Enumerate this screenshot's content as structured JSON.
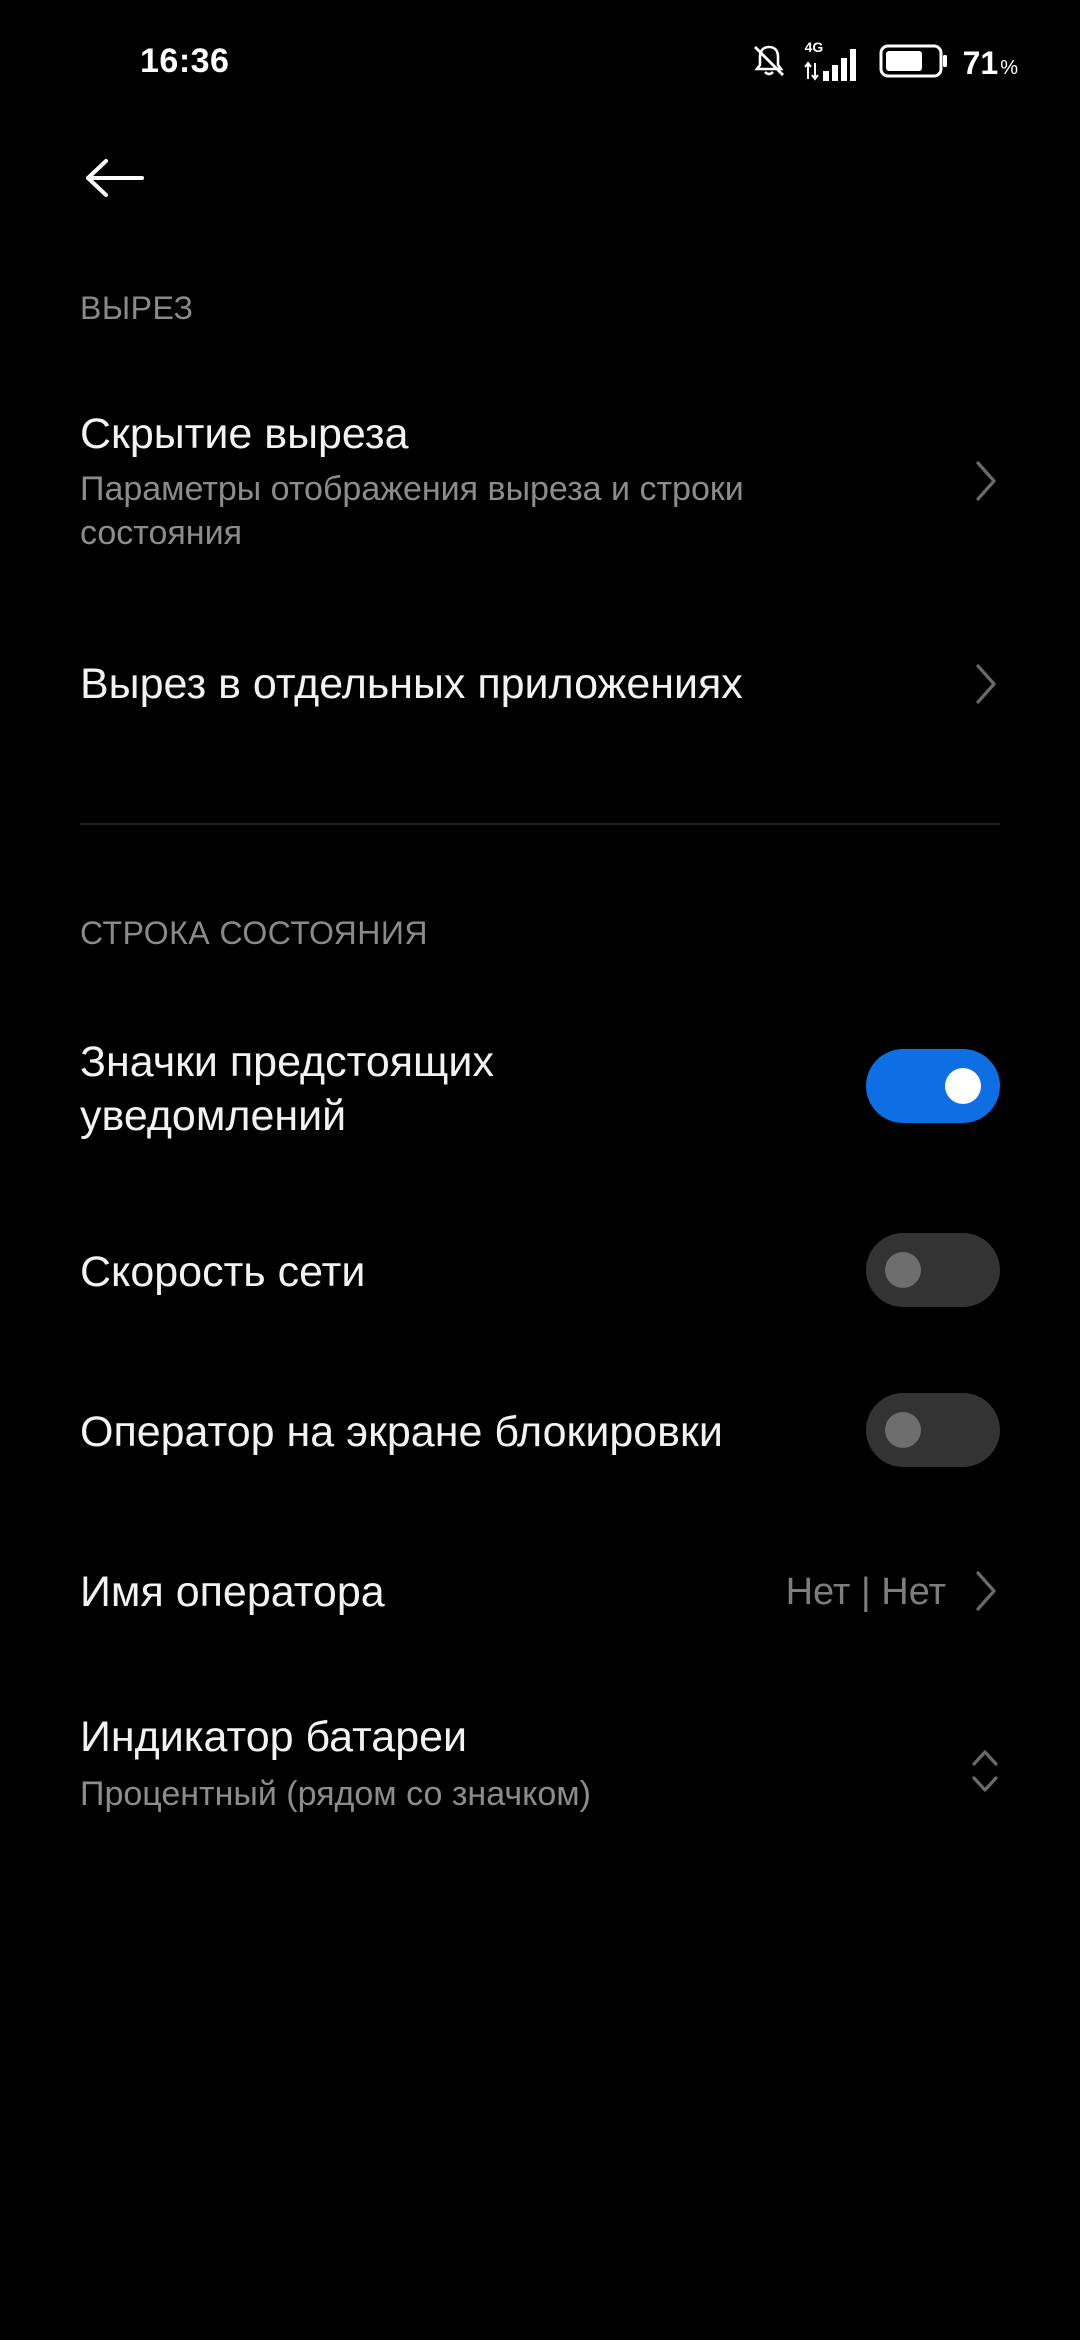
{
  "status_bar": {
    "time": "16:36",
    "network_type": "4G",
    "battery_percent": "71",
    "battery_unit": "%",
    "battery_level": 0.71,
    "icons": [
      "silent-mode-icon",
      "signal-icon",
      "battery-icon"
    ]
  },
  "header": {
    "back_icon": "arrow-left-icon"
  },
  "sections": {
    "cutout": {
      "title": "ВЫРЕЗ",
      "items": {
        "hide_cutout": {
          "title": "Скрытие выреза",
          "subtitle": "Параметры отображения выреза и строки состояния"
        },
        "per_app": {
          "title": "Вырез в отдельных приложениях"
        }
      }
    },
    "status_bar": {
      "title": "СТРОКА СОСТОЯНИЯ",
      "items": {
        "notification_icons": {
          "title": "Значки предстоящих уведомлений",
          "enabled": true
        },
        "network_speed": {
          "title": "Скорость сети",
          "enabled": false
        },
        "carrier_lockscreen": {
          "title": "Оператор на экране блокировки",
          "enabled": false
        },
        "carrier_name": {
          "title": "Имя оператора",
          "value": "Нет | Нет"
        },
        "battery_indicator": {
          "title": "Индикатор батареи",
          "subtitle": "Процентный (рядом со значком)"
        }
      }
    }
  },
  "colors": {
    "background": "#000000",
    "accent": "#0d6fe3",
    "primary_text": "#f2f2f2",
    "secondary_text": "#8c8c8c",
    "toggle_off": "#333333"
  }
}
